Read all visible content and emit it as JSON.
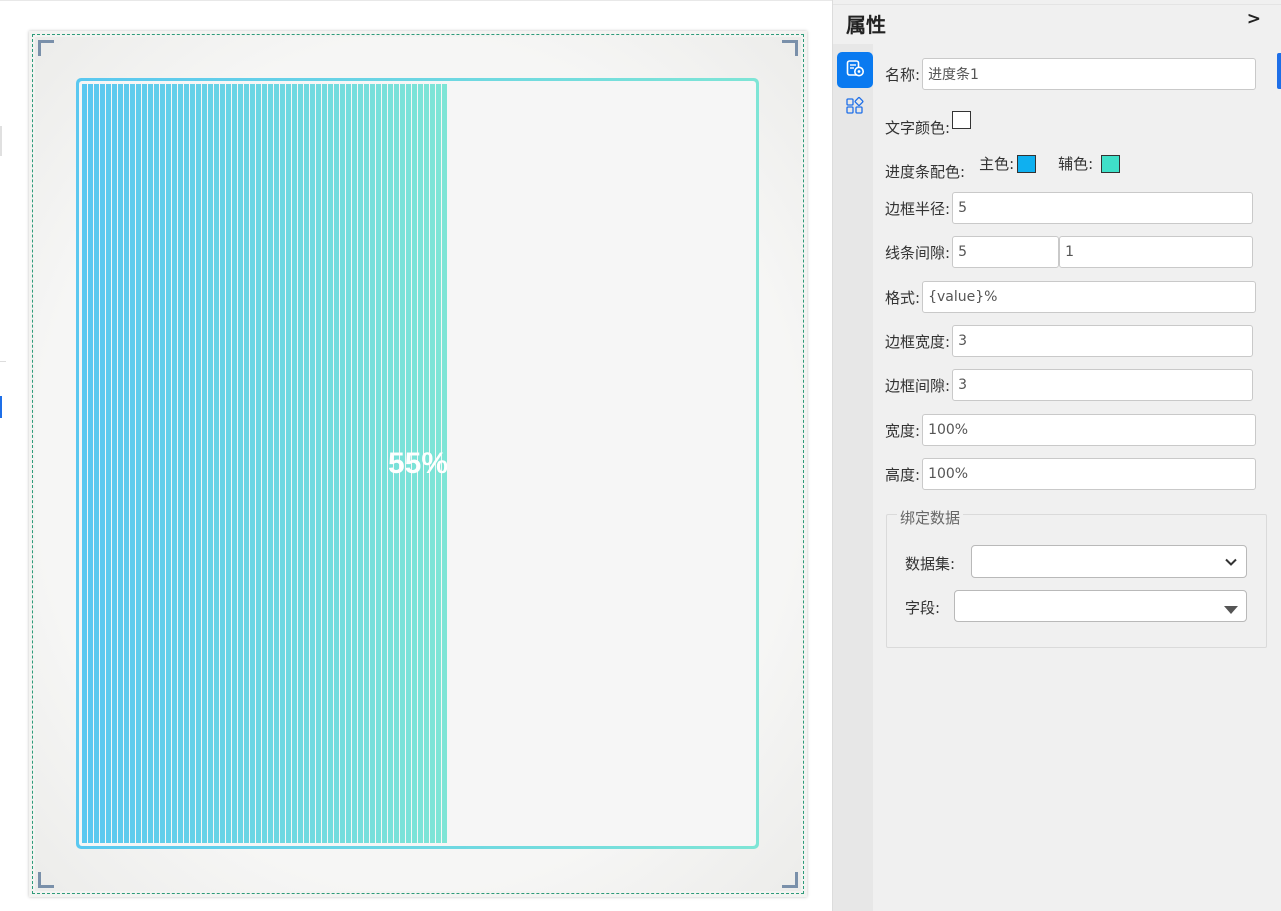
{
  "progress": {
    "value": 55,
    "label": "55%",
    "primary_color": "#5ac8f0",
    "secondary_color": "#7ee5d6"
  },
  "panel": {
    "title": "属性",
    "collapse_label": ">",
    "rail_icons": [
      "properties-settings-icon",
      "components-icon"
    ],
    "fields": {
      "name_label": "名称:",
      "name_value": "进度条1",
      "text_color_label": "文字颜色:",
      "text_color": "#ffffff",
      "bar_color_label": "进度条配色:",
      "primary_label": "主色:",
      "primary_color": "#0fb0f0",
      "secondary_label": "辅色:",
      "secondary_color": "#3fe0c8",
      "radius_label": "边框半径:",
      "radius_value": "5",
      "line_gap_label": "线条间隙:",
      "line_width_value": "5",
      "line_gap_value": "1",
      "format_label": "格式:",
      "format_value": "{value}%",
      "border_width_label": "边框宽度:",
      "border_width_value": "3",
      "border_gap_label": "边框间隙:",
      "border_gap_value": "3",
      "width_label": "宽度:",
      "width_value": "100%",
      "height_label": "高度:",
      "height_value": "100%"
    },
    "binding": {
      "legend": "绑定数据",
      "dataset_label": "数据集:",
      "dataset_value": "",
      "field_label": "字段:",
      "field_value": ""
    }
  }
}
